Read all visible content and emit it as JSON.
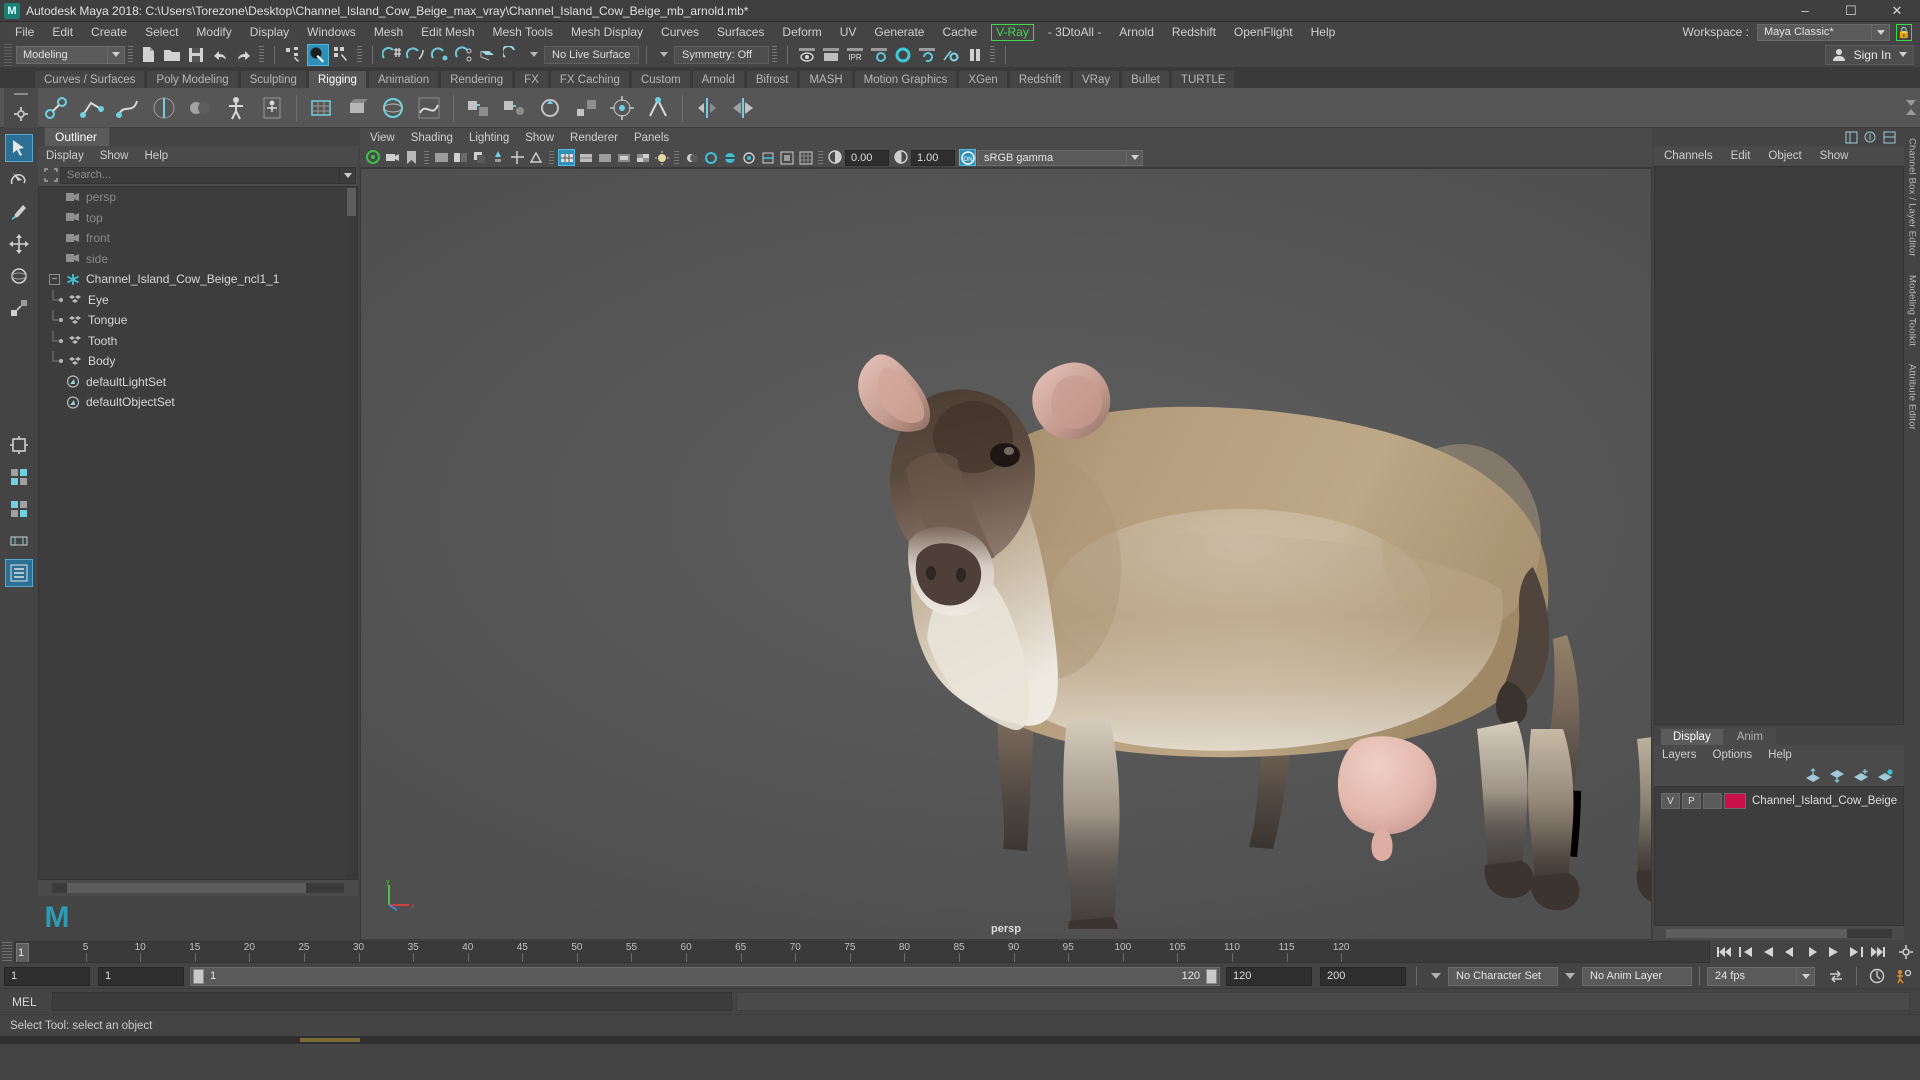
{
  "window": {
    "title": "Autodesk Maya 2018: C:\\Users\\Torezone\\Desktop\\Channel_Island_Cow_Beige_max_vray\\Channel_Island_Cow_Beige_mb_arnold.mb*",
    "logo": "M",
    "minimize": "–",
    "maximize": "☐",
    "close": "✕"
  },
  "menubar": {
    "items": [
      "File",
      "Edit",
      "Create",
      "Select",
      "Modify",
      "Display",
      "Windows",
      "Mesh",
      "Edit Mesh",
      "Mesh Tools",
      "Mesh Display",
      "Curves",
      "Surfaces",
      "Deform",
      "UV",
      "Generate",
      "Cache"
    ],
    "vray": "V-Ray",
    "items_after": [
      "- 3DtoAll -",
      "Arnold",
      "Redshift",
      "OpenFlight",
      "Help"
    ],
    "workspace_label": "Workspace :",
    "workspace_value": "Maya Classic*",
    "lock_icon": "lock-icon"
  },
  "statusline": {
    "menuset": "Modeling",
    "live_surface": "No Live Surface",
    "symmetry": "Symmetry: Off",
    "signin": "Sign In"
  },
  "shelf": {
    "tabs": [
      "Curves / Surfaces",
      "Poly Modeling",
      "Sculpting",
      "Rigging",
      "Animation",
      "Rendering",
      "FX",
      "FX Caching",
      "Custom",
      "Arnold",
      "Bifrost",
      "MASH",
      "Motion Graphics",
      "XGen",
      "Redshift",
      "VRay",
      "Bullet",
      "TURTLE"
    ],
    "active_tab": "Rigging"
  },
  "outliner": {
    "tab": "Outliner",
    "menu": [
      "Display",
      "Show",
      "Help"
    ],
    "search_placeholder": "Search...",
    "items": [
      {
        "label": "persp",
        "type": "camera",
        "indent": 1,
        "dim": true
      },
      {
        "label": "top",
        "type": "camera",
        "indent": 1,
        "dim": true
      },
      {
        "label": "front",
        "type": "camera",
        "indent": 1,
        "dim": true
      },
      {
        "label": "side",
        "type": "camera",
        "indent": 1,
        "dim": true
      },
      {
        "label": "Channel_Island_Cow_Beige_ncl1_1",
        "type": "group",
        "indent": 0,
        "dim": false
      },
      {
        "label": "Eye",
        "type": "mesh",
        "indent": 2,
        "dim": false
      },
      {
        "label": "Tongue",
        "type": "mesh",
        "indent": 2,
        "dim": false
      },
      {
        "label": "Tooth",
        "type": "mesh",
        "indent": 2,
        "dim": false
      },
      {
        "label": "Body",
        "type": "mesh",
        "indent": 2,
        "dim": false
      },
      {
        "label": "defaultLightSet",
        "type": "set",
        "indent": 1,
        "dim": false
      },
      {
        "label": "defaultObjectSet",
        "type": "set",
        "indent": 1,
        "dim": false
      }
    ]
  },
  "viewport": {
    "menu": [
      "View",
      "Shading",
      "Lighting",
      "Show",
      "Renderer",
      "Panels"
    ],
    "exposure": "0.00",
    "gamma": "1.00",
    "color_mode": "sRGB gamma",
    "camera_label": "persp"
  },
  "channelbox": {
    "tabs": [
      "Channels",
      "Edit",
      "Object",
      "Show"
    ],
    "vertical_tabs": [
      "Channel Box / Layer Editor",
      "Modeling Toolkit",
      "Attribute Editor"
    ]
  },
  "layers": {
    "tabs": [
      "Display",
      "Anim"
    ],
    "active_tab": "Display",
    "menu": [
      "Layers",
      "Options",
      "Help"
    ],
    "rows": [
      {
        "visibility": "V",
        "playback": "P",
        "state": "",
        "color": "#c8104a",
        "name": "Channel_Island_Cow_Beige"
      }
    ]
  },
  "timeline": {
    "current_frame": "1",
    "ticks": [
      5,
      10,
      15,
      20,
      25,
      30,
      35,
      40,
      45,
      50,
      55,
      60,
      65,
      70,
      75,
      80,
      85,
      90,
      95,
      100,
      105,
      110,
      115,
      120
    ],
    "range_start": "1",
    "range_start2": "1",
    "slider_min": "1",
    "slider_max": "120",
    "range_end": "120",
    "playback_end": "200",
    "character_set": "No Character Set",
    "anim_layer": "No Anim Layer",
    "fps": "24 fps"
  },
  "command": {
    "label": "MEL",
    "input_value": "",
    "status": "Select Tool: select an object"
  }
}
